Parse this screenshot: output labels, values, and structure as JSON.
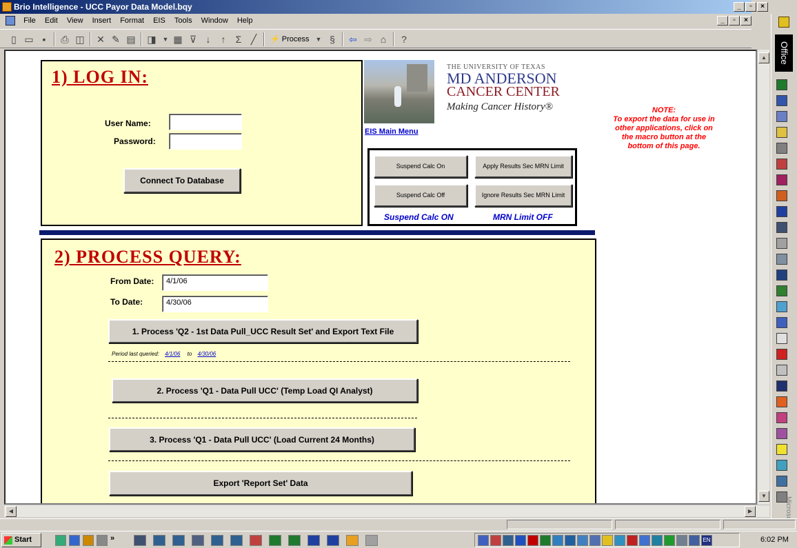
{
  "window": {
    "title": "Brio Intelligence - UCC Payor Data Model.bqy",
    "min": "_",
    "max": "▫",
    "close": "×"
  },
  "menu": [
    "File",
    "Edit",
    "View",
    "Insert",
    "Format",
    "EIS",
    "Tools",
    "Window",
    "Help"
  ],
  "toolbar": {
    "process_label": "Process"
  },
  "officebar": {
    "label": "Office",
    "bottom_label": "Microsoft"
  },
  "login": {
    "heading": "1) LOG IN:",
    "username_label": "User Name:",
    "username_value": "",
    "password_label": "Password:",
    "password_value": "",
    "connect_button": "Connect To Database"
  },
  "brand": {
    "line1": "THE UNIVERSITY OF TEXAS",
    "line2": "MD ANDERSON",
    "line3": "CANCER CENTER",
    "tagline": "Making Cancer History®",
    "eis_link": "EIS Main Menu"
  },
  "controls": {
    "suspend_on": "Suspend Calc On",
    "suspend_off": "Suspend Calc Off",
    "apply_mrn": "Apply Results Sec MRN Limit",
    "ignore_mrn": "Ignore Results Sec MRN Limit",
    "status_calc": "Suspend Calc ON",
    "status_mrn": "MRN Limit OFF"
  },
  "note": "NOTE:\nTo export the data for use in other applications, click on the macro button at the bottom of this page.",
  "query": {
    "heading": "2) PROCESS QUERY:",
    "from_label": "From Date:",
    "from_value": "4/1/06",
    "to_label": "To Date:",
    "to_value": "4/30/06",
    "btn1": "1. Process 'Q2 - 1st Data Pull_UCC Result Set' and Export Text File",
    "period_label": "Period last queried:",
    "period_from": "4/1/06",
    "period_to_word": "to",
    "period_to": "4/30/06",
    "btn2": "2.  Process 'Q1 - Data Pull UCC'  (Temp Load QI Analyst)",
    "btn3": "3.  Process 'Q1 - Data Pull UCC'  (Load Current 24 Months)",
    "btn4": "Export 'Report Set' Data"
  },
  "taskbar": {
    "start": "Start",
    "lang": "EN",
    "clock": "6:02 PM"
  }
}
